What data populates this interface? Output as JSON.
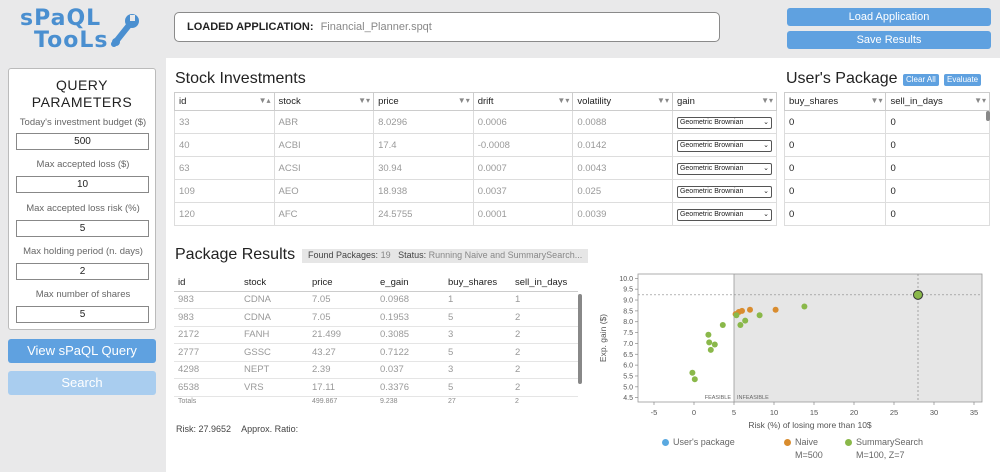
{
  "header": {
    "logo_line1": "sPaQL",
    "logo_line2": "TooLs",
    "loaded_label": "LOADED APPLICATION:",
    "loaded_value": "Financial_Planner.spqt",
    "load_button": "Load Application",
    "save_button": "Save Results"
  },
  "sidebar": {
    "title_line1": "QUERY",
    "title_line2": "PARAMETERS",
    "params": [
      {
        "label": "Today's investment budget ($)",
        "value": "500"
      },
      {
        "label": "Max accepted loss ($)",
        "value": "10"
      },
      {
        "label": "Max accepted loss risk (%)",
        "value": "5"
      },
      {
        "label": "Max holding period (n. days)",
        "value": "2"
      },
      {
        "label": "Max number of shares",
        "value": "5"
      }
    ],
    "view_button": "View sPaQL Query",
    "search_button": "Search"
  },
  "stock": {
    "title": "Stock Investments",
    "columns": [
      "id",
      "stock",
      "price",
      "drift",
      "volatility",
      "gain"
    ],
    "rows": [
      [
        "33",
        "ABR",
        "8.0296",
        "0.0006",
        "0.0088",
        "Geometric Brownian"
      ],
      [
        "40",
        "ACBI",
        "17.4",
        "-0.0008",
        "0.0142",
        "Geometric Brownian"
      ],
      [
        "63",
        "ACSI",
        "30.94",
        "0.0007",
        "0.0043",
        "Geometric Brownian"
      ],
      [
        "109",
        "AEO",
        "18.938",
        "0.0037",
        "0.025",
        "Geometric Brownian"
      ],
      [
        "120",
        "AFC",
        "24.5755",
        "0.0001",
        "0.0039",
        "Geometric Brownian"
      ]
    ]
  },
  "user_package": {
    "title": "User's Package",
    "clear_button": "Clear All",
    "evaluate_button": "Evaluate",
    "columns": [
      "buy_shares",
      "sell_in_days"
    ],
    "rows": [
      [
        "0",
        "0"
      ],
      [
        "0",
        "0"
      ],
      [
        "0",
        "0"
      ],
      [
        "0",
        "0"
      ],
      [
        "0",
        "0"
      ]
    ]
  },
  "results": {
    "title": "Package Results",
    "found_label": "Found Packages:",
    "found_value": "19",
    "status_label": "Status:",
    "status_value": "Running Naive and SummarySearch...",
    "columns": [
      "id",
      "stock",
      "price",
      "e_gain",
      "buy_shares",
      "sell_in_days"
    ],
    "rows": [
      [
        "983",
        "CDNA",
        "7.05",
        "0.0968",
        "1",
        "1"
      ],
      [
        "983",
        "CDNA",
        "7.05",
        "0.1953",
        "5",
        "2"
      ],
      [
        "2172",
        "FANH",
        "21.499",
        "0.3085",
        "3",
        "2"
      ],
      [
        "2777",
        "GSSC",
        "43.27",
        "0.7122",
        "5",
        "2"
      ],
      [
        "4298",
        "NEPT",
        "2.39",
        "0.037",
        "3",
        "2"
      ],
      [
        "6538",
        "VRS",
        "17.11",
        "0.3376",
        "5",
        "2"
      ]
    ],
    "totals": [
      "Totals",
      "",
      "499.867",
      "9.238",
      "27",
      "2"
    ],
    "risk_label": "Risk:",
    "risk_value": "27.9652",
    "ratio_label": "Approx. Ratio:"
  },
  "chart_data": {
    "type": "scatter",
    "xlabel": "Risk (%) of losing more than 10$",
    "ylabel": "Exp. gain ($)",
    "xlim": [
      -7,
      36
    ],
    "ylim": [
      4.3,
      10.2
    ],
    "xticks": [
      "-5",
      "0",
      "5",
      "10",
      "15",
      "20",
      "25",
      "30",
      "35"
    ],
    "yticks": [
      "4.5",
      "5.0",
      "5.5",
      "6.0",
      "6.5",
      "7.0",
      "7.5",
      "8.0",
      "8.5",
      "9.0",
      "9.5",
      "10.0"
    ],
    "feasible_label": "FEASIBLE",
    "infeasible_label": "INFEASIBLE",
    "threshold_x": 5,
    "selected": {
      "x": 28,
      "y": 9.24
    },
    "series": [
      {
        "name": "User's package",
        "color": "#5aa9e0",
        "points": []
      },
      {
        "name": "Naive",
        "sub": "M=500",
        "color": "#d98c2e",
        "points": [
          [
            5.2,
            8.35
          ],
          [
            5.6,
            8.45
          ],
          [
            6.0,
            8.5
          ],
          [
            7.0,
            8.55
          ],
          [
            10.2,
            8.55
          ]
        ]
      },
      {
        "name": "SummarySearch",
        "sub": "M=100, Z=7",
        "color": "#8ab84a",
        "points": [
          [
            -0.2,
            5.65
          ],
          [
            0.1,
            5.35
          ],
          [
            1.8,
            7.4
          ],
          [
            1.9,
            7.05
          ],
          [
            2.1,
            6.7
          ],
          [
            2.6,
            6.95
          ],
          [
            3.6,
            7.85
          ],
          [
            5.3,
            8.3
          ],
          [
            5.8,
            7.85
          ],
          [
            6.4,
            8.05
          ],
          [
            8.2,
            8.3
          ],
          [
            13.8,
            8.7
          ],
          [
            28,
            9.24
          ]
        ]
      }
    ]
  }
}
